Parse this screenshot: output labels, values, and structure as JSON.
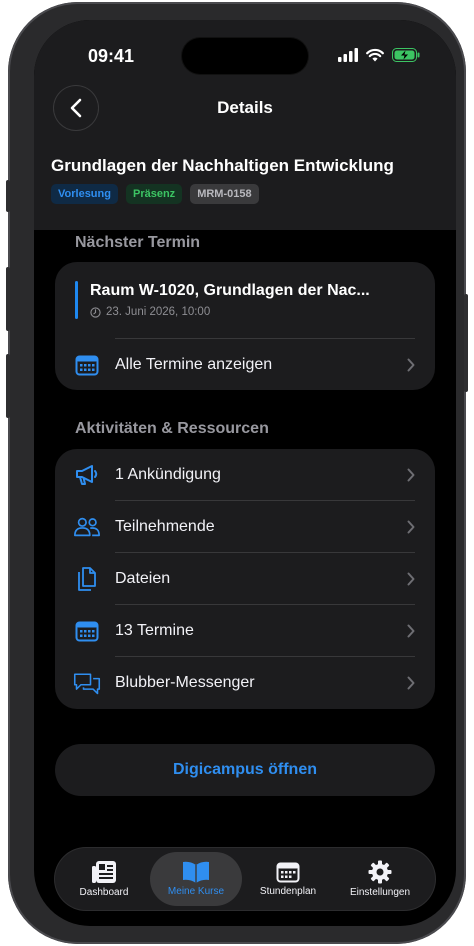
{
  "status_bar": {
    "time": "09:41"
  },
  "nav": {
    "title": "Details"
  },
  "course": {
    "title": "Grundlagen der Nachhaltigen Entwicklung",
    "badges": [
      "Vorlesung",
      "Präsenz",
      "MRM-0158"
    ]
  },
  "next_appointment": {
    "header": "Nächster Termin",
    "title": "Raum W-1020, Grundlagen der Nac...",
    "date": "23. Juni 2026, 10:00",
    "all_label": "Alle Termine anzeigen"
  },
  "activities": {
    "header": "Aktivitäten & Ressourcen",
    "items": [
      {
        "label": "1 Ankündigung",
        "icon": "megaphone-icon"
      },
      {
        "label": "Teilnehmende",
        "icon": "people-icon"
      },
      {
        "label": "Dateien",
        "icon": "documents-icon"
      },
      {
        "label": "13 Termine",
        "icon": "calendar-icon"
      },
      {
        "label": "Blubber-Messenger",
        "icon": "chat-bubbles-icon"
      }
    ]
  },
  "open_button": {
    "label": "Digicampus öffnen"
  },
  "tabbar": {
    "tabs": [
      {
        "label": "Dashboard",
        "icon": "dashboard-icon"
      },
      {
        "label": "Meine Kurse",
        "icon": "book-icon",
        "active": true
      },
      {
        "label": "Stundenplan",
        "icon": "calendar-icon"
      },
      {
        "label": "Einstellungen",
        "icon": "gear-icon"
      }
    ]
  },
  "colors": {
    "accent": "#2f8ef0",
    "background": "#000000",
    "card": "#1c1c1e"
  }
}
